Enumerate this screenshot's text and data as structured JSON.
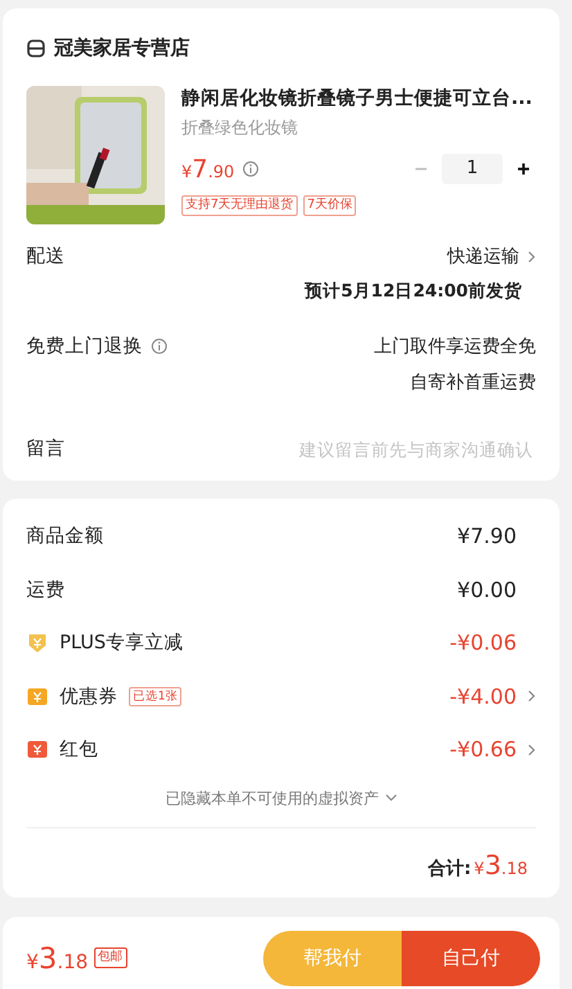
{
  "store": {
    "name": "冠美家居专营店"
  },
  "product": {
    "title": "静闲居化妆镜折叠镜子男士便捷可立台...",
    "variant": "折叠绿色化妆镜",
    "price": {
      "symbol": "¥",
      "whole": "7",
      "fraction": ".90"
    },
    "quantity": "1",
    "minus_disabled": true,
    "tags": [
      "支持7天无理由退货",
      "7天价保"
    ]
  },
  "delivery": {
    "label": "配送",
    "method": "快递运输",
    "estimate": "预计5月12日24:00前发货"
  },
  "returns": {
    "label": "免费上门退换",
    "lines": [
      "上门取件享运费全免",
      "自寄补首重运费"
    ]
  },
  "note": {
    "label": "留言",
    "placeholder": "建议留言前先与商家沟通确认"
  },
  "fees": [
    {
      "kind": "plain",
      "label": "商品金额",
      "amount": "¥7.90",
      "arrow": false
    },
    {
      "kind": "plain",
      "label": "运费",
      "amount": "¥0.00",
      "arrow": false
    },
    {
      "kind": "plus",
      "label": "PLUS专享立减",
      "amount": "-¥0.06",
      "arrow": false
    },
    {
      "kind": "coupon",
      "label": "优惠券",
      "tag": "已选1张",
      "amount": "-¥4.00",
      "arrow": true
    },
    {
      "kind": "redpacket",
      "label": "红包",
      "amount": "-¥0.66",
      "arrow": true
    }
  ],
  "hidden_assets": "已隐藏本单不可使用的虚拟资产",
  "total": {
    "label": "合计:",
    "symbol": "¥",
    "whole": "3",
    "fraction": ".18"
  },
  "footer": {
    "symbol": "¥",
    "whole": "3",
    "fraction": ".18",
    "badge": "包邮",
    "buttons": [
      {
        "kind": "secondary",
        "label": "帮我付"
      },
      {
        "kind": "primary",
        "label": "自己付"
      }
    ]
  }
}
